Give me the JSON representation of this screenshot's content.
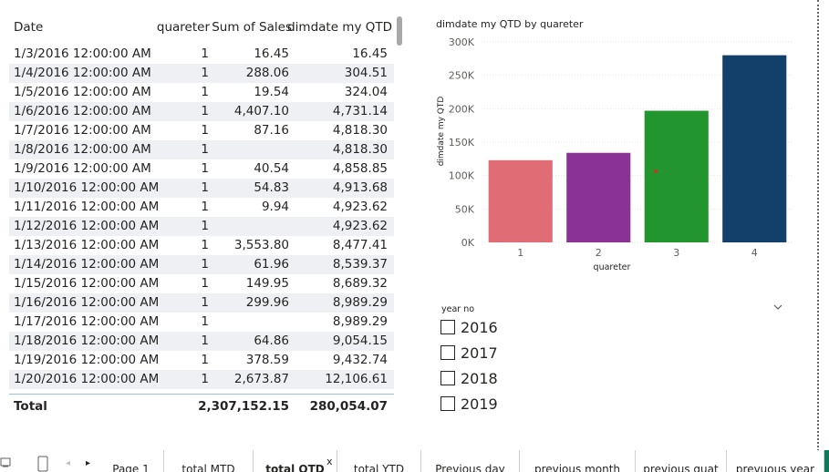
{
  "table": {
    "headers": {
      "date": "Date",
      "quarter": "quareter",
      "sales": "Sum of Sales",
      "qtd": "dimdate my QTD"
    },
    "rows": [
      {
        "date": "1/3/2016 12:00:00 AM",
        "quarter": "1",
        "sales": "16.45",
        "qtd": "16.45"
      },
      {
        "date": "1/4/2016 12:00:00 AM",
        "quarter": "1",
        "sales": "288.06",
        "qtd": "304.51"
      },
      {
        "date": "1/5/2016 12:00:00 AM",
        "quarter": "1",
        "sales": "19.54",
        "qtd": "324.04"
      },
      {
        "date": "1/6/2016 12:00:00 AM",
        "quarter": "1",
        "sales": "4,407.10",
        "qtd": "4,731.14"
      },
      {
        "date": "1/7/2016 12:00:00 AM",
        "quarter": "1",
        "sales": "87.16",
        "qtd": "4,818.30"
      },
      {
        "date": "1/8/2016 12:00:00 AM",
        "quarter": "1",
        "sales": "",
        "qtd": "4,818.30"
      },
      {
        "date": "1/9/2016 12:00:00 AM",
        "quarter": "1",
        "sales": "40.54",
        "qtd": "4,858.85"
      },
      {
        "date": "1/10/2016 12:00:00 AM",
        "quarter": "1",
        "sales": "54.83",
        "qtd": "4,913.68"
      },
      {
        "date": "1/11/2016 12:00:00 AM",
        "quarter": "1",
        "sales": "9.94",
        "qtd": "4,923.62"
      },
      {
        "date": "1/12/2016 12:00:00 AM",
        "quarter": "1",
        "sales": "",
        "qtd": "4,923.62"
      },
      {
        "date": "1/13/2016 12:00:00 AM",
        "quarter": "1",
        "sales": "3,553.80",
        "qtd": "8,477.41"
      },
      {
        "date": "1/14/2016 12:00:00 AM",
        "quarter": "1",
        "sales": "61.96",
        "qtd": "8,539.37"
      },
      {
        "date": "1/15/2016 12:00:00 AM",
        "quarter": "1",
        "sales": "149.95",
        "qtd": "8,689.32"
      },
      {
        "date": "1/16/2016 12:00:00 AM",
        "quarter": "1",
        "sales": "299.96",
        "qtd": "8,989.29"
      },
      {
        "date": "1/17/2016 12:00:00 AM",
        "quarter": "1",
        "sales": "",
        "qtd": "8,989.29"
      },
      {
        "date": "1/18/2016 12:00:00 AM",
        "quarter": "1",
        "sales": "64.86",
        "qtd": "9,054.15"
      },
      {
        "date": "1/19/2016 12:00:00 AM",
        "quarter": "1",
        "sales": "378.59",
        "qtd": "9,432.74"
      },
      {
        "date": "1/20/2016 12:00:00 AM",
        "quarter": "1",
        "sales": "2,673.87",
        "qtd": "12,106.61"
      }
    ],
    "total": {
      "label": "Total",
      "sales": "2,307,152.15",
      "qtd": "280,054.07"
    }
  },
  "chart_data": {
    "type": "bar",
    "title": "dimdate my QTD by quareter",
    "xlabel": "quareter",
    "ylabel": "dimdate my QTD",
    "categories": [
      "1",
      "2",
      "3",
      "4"
    ],
    "values": [
      123000,
      134000,
      197000,
      280054
    ],
    "colors": [
      "#e06c75",
      "#8a3296",
      "#23952f",
      "#12406b"
    ],
    "yticks": [
      "0K",
      "50K",
      "100K",
      "150K",
      "200K",
      "250K",
      "300K"
    ],
    "ylim": [
      0,
      300000
    ],
    "grid": true
  },
  "slicer": {
    "title": "year no",
    "items": [
      "2016",
      "2017",
      "2018",
      "2019"
    ]
  },
  "tabs": {
    "items": [
      "Page 1",
      "total MTD",
      "total QTD",
      "total YTD",
      "Previous day",
      "previous month",
      "previous quat",
      "prevuous year"
    ],
    "active": "total QTD",
    "close_glyph": "x"
  }
}
